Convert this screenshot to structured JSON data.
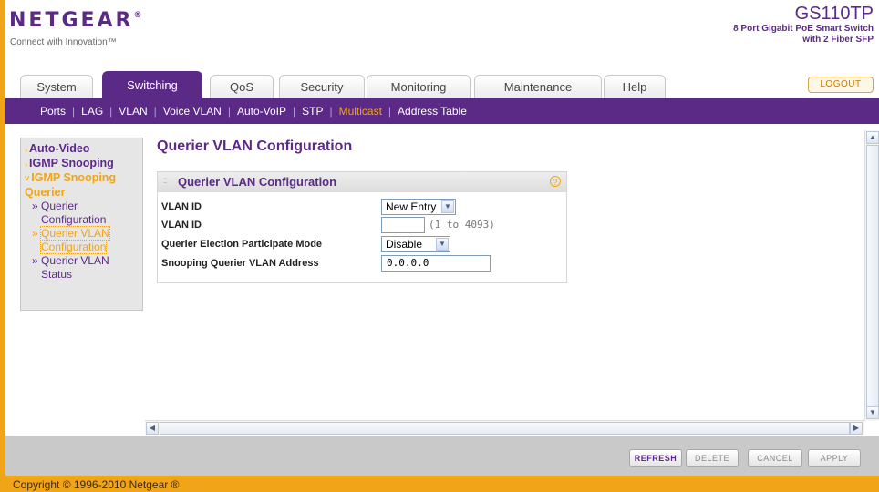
{
  "header": {
    "logo": "NETGEAR",
    "logo_reg": "®",
    "tagline": "Connect with Innovation™",
    "model": "GS110TP",
    "model_desc_1": "8 Port Gigabit PoE Smart Switch",
    "model_desc_2": "with 2 Fiber SFP"
  },
  "tabs": [
    {
      "label": "System"
    },
    {
      "label": "Switching"
    },
    {
      "label": "QoS"
    },
    {
      "label": "Security"
    },
    {
      "label": "Monitoring"
    },
    {
      "label": "Maintenance"
    },
    {
      "label": "Help"
    }
  ],
  "logout_label": "LOGOUT",
  "subnav": {
    "items": [
      "Ports",
      "LAG",
      "VLAN",
      "Voice VLAN",
      "Auto-VoIP",
      "STP",
      "Multicast",
      "Address Table"
    ],
    "separator": "|"
  },
  "sidebar": {
    "auto_video": "Auto-Video",
    "igmp_snooping": "IGMP Snooping",
    "igmp_querier": "IGMP Snooping Querier",
    "querier_config_1": "Querier",
    "querier_config_2": "Configuration",
    "querier_vlan_config_1": "Querier VLAN",
    "querier_vlan_config_2": "Configuration",
    "querier_vlan_status_1": "Querier VLAN",
    "querier_vlan_status_2": "Status",
    "bullet_closed": "›",
    "bullet_open": "˅",
    "sub_bullet": "»"
  },
  "page_title": "Querier VLAN Configuration",
  "panel": {
    "title": "Querier VLAN Configuration",
    "help": "?",
    "rows": {
      "vlan_id_select_label": "VLAN ID",
      "vlan_id_select_value": "New Entry",
      "vlan_id_input_label": "VLAN ID",
      "vlan_id_input_value": "",
      "vlan_id_range": "(1 to 4093)",
      "election_label": "Querier Election Participate Mode",
      "election_value": "Disable",
      "address_label": "Snooping Querier VLAN Address",
      "address_value": "0.0.0.0"
    }
  },
  "buttons": {
    "refresh": "REFRESH",
    "delete": "DELETE",
    "cancel": "CANCEL",
    "apply": "APPLY"
  },
  "footer": "Copyright © 1996-2010 Netgear ®",
  "colors": {
    "brand_purple": "#5b2a86",
    "accent_orange": "#f0a418"
  }
}
